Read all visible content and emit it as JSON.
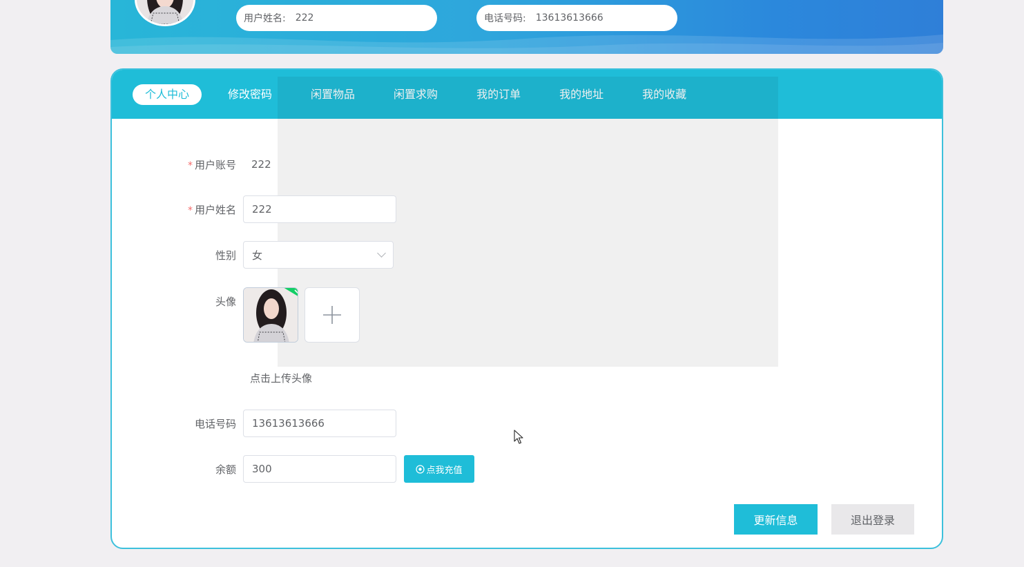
{
  "header": {
    "name_label": "用户姓名:",
    "name_value": "222",
    "phone_label": "电话号码:",
    "phone_value": "13613613666"
  },
  "tabs": [
    {
      "label": "个人中心",
      "active": true
    },
    {
      "label": "修改密码",
      "active": false
    },
    {
      "label": "闲置物品",
      "active": false
    },
    {
      "label": "闲置求购",
      "active": false
    },
    {
      "label": "我的订单",
      "active": false
    },
    {
      "label": "我的地址",
      "active": false
    },
    {
      "label": "我的收藏",
      "active": false
    }
  ],
  "form": {
    "account_label": "用户账号",
    "account_value": "222",
    "name_label": "用户姓名",
    "name_value": "222",
    "gender_label": "性别",
    "gender_value": "女",
    "avatar_label": "头像",
    "avatar_hint": "点击上传头像",
    "phone_label": "电话号码",
    "phone_value": "13613613666",
    "balance_label": "余额",
    "balance_value": "300",
    "recharge_label": "点我充值",
    "required_mark": "*"
  },
  "actions": {
    "update_label": "更新信息",
    "logout_label": "退出登录"
  },
  "colors": {
    "accent": "#1fbdd8",
    "required": "#f56c6c",
    "upload_success": "#13ce66"
  }
}
